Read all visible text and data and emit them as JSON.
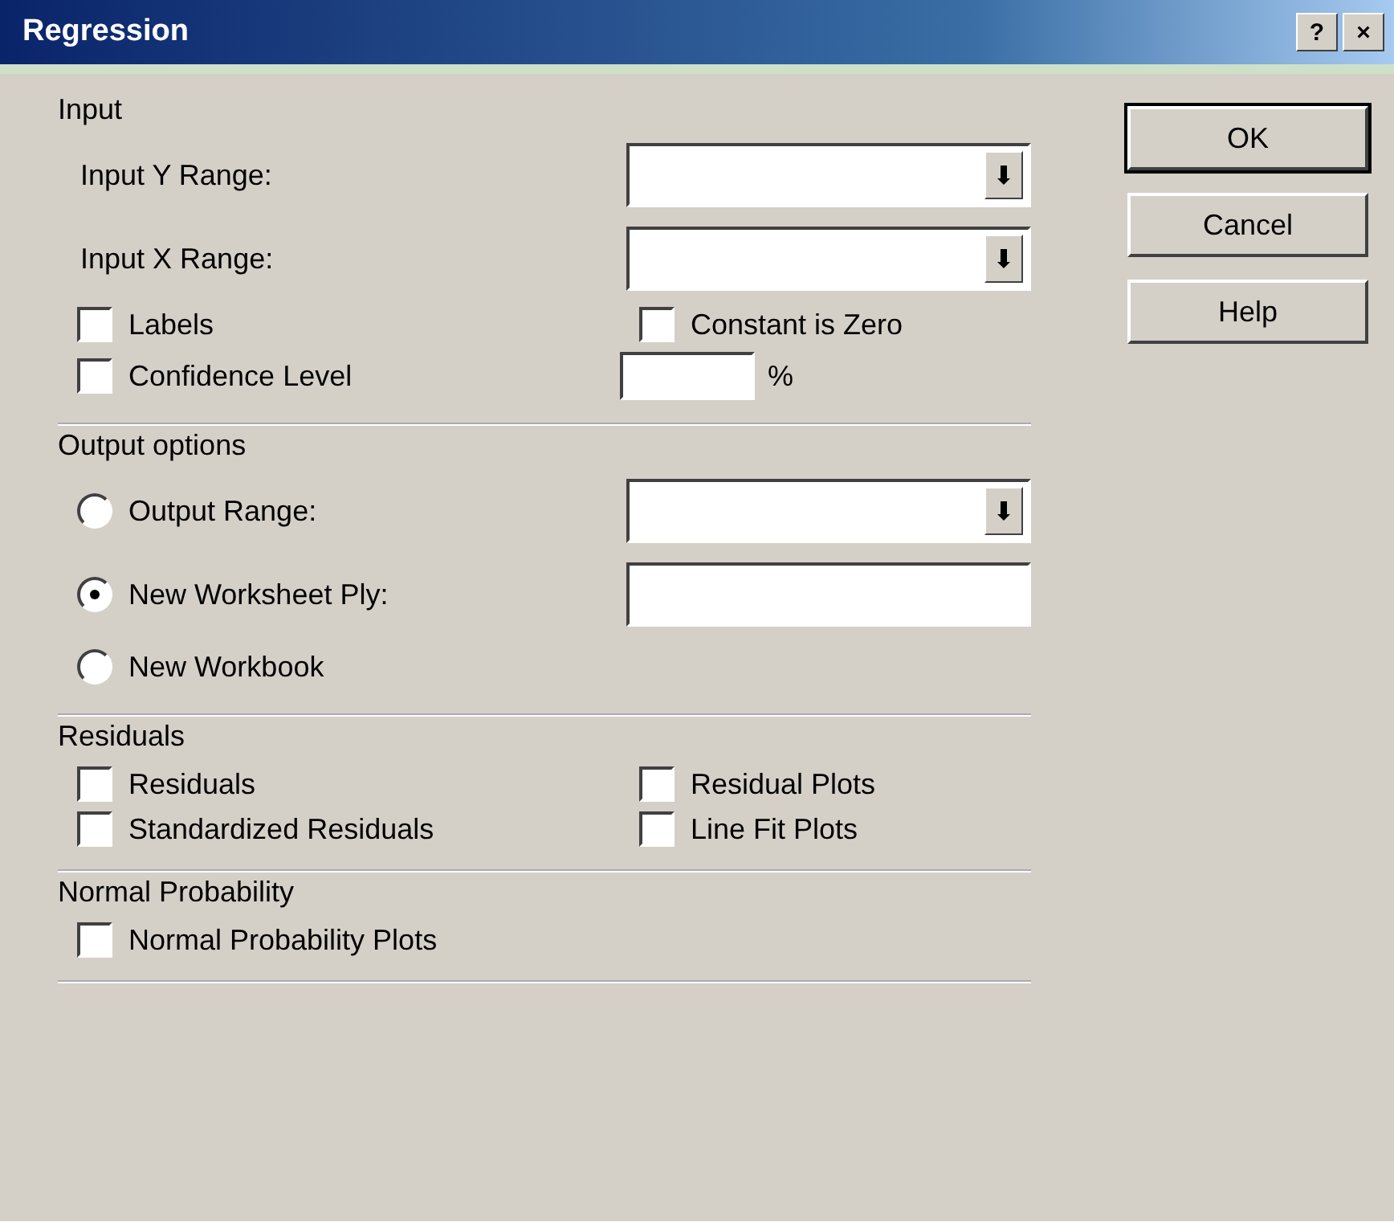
{
  "window": {
    "title": "Regression",
    "buttons": [
      "?",
      "×"
    ]
  },
  "input": {
    "label": "Input",
    "ranges": [
      {
        "label": "Input Y Range:"
      },
      {
        "label": "Input X Range:"
      }
    ],
    "labels": {
      "label": "Labels",
      "checked": false
    },
    "constant_zero": {
      "label": "Constant is Zero",
      "checked": false
    },
    "confidence": {
      "label": "Confidence Level",
      "checked": false,
      "unit": "%"
    }
  },
  "output_options": {
    "label": "Output options",
    "choices": [
      {
        "label": "Output Range:",
        "selected": false,
        "kind": "range"
      },
      {
        "label": "New Worksheet Ply:",
        "selected": true,
        "kind": "text"
      },
      {
        "label": "New Workbook",
        "selected": false,
        "kind": "none"
      }
    ]
  },
  "residuals": {
    "label": "Residuals",
    "options": [
      {
        "label": "Residuals",
        "checked": false
      },
      {
        "label": "Residual Plots",
        "checked": false
      },
      {
        "label": "Standardized Residuals",
        "checked": false
      },
      {
        "label": "Line Fit Plots",
        "checked": false
      }
    ]
  },
  "normal_probability": {
    "label": "Normal Probability",
    "options": [
      {
        "label": "Normal Probability Plots",
        "checked": false
      }
    ]
  },
  "buttons": [
    {
      "label": "OK",
      "default": true
    },
    {
      "label": "Cancel",
      "default": false
    },
    {
      "label": "Help",
      "default": false
    }
  ]
}
